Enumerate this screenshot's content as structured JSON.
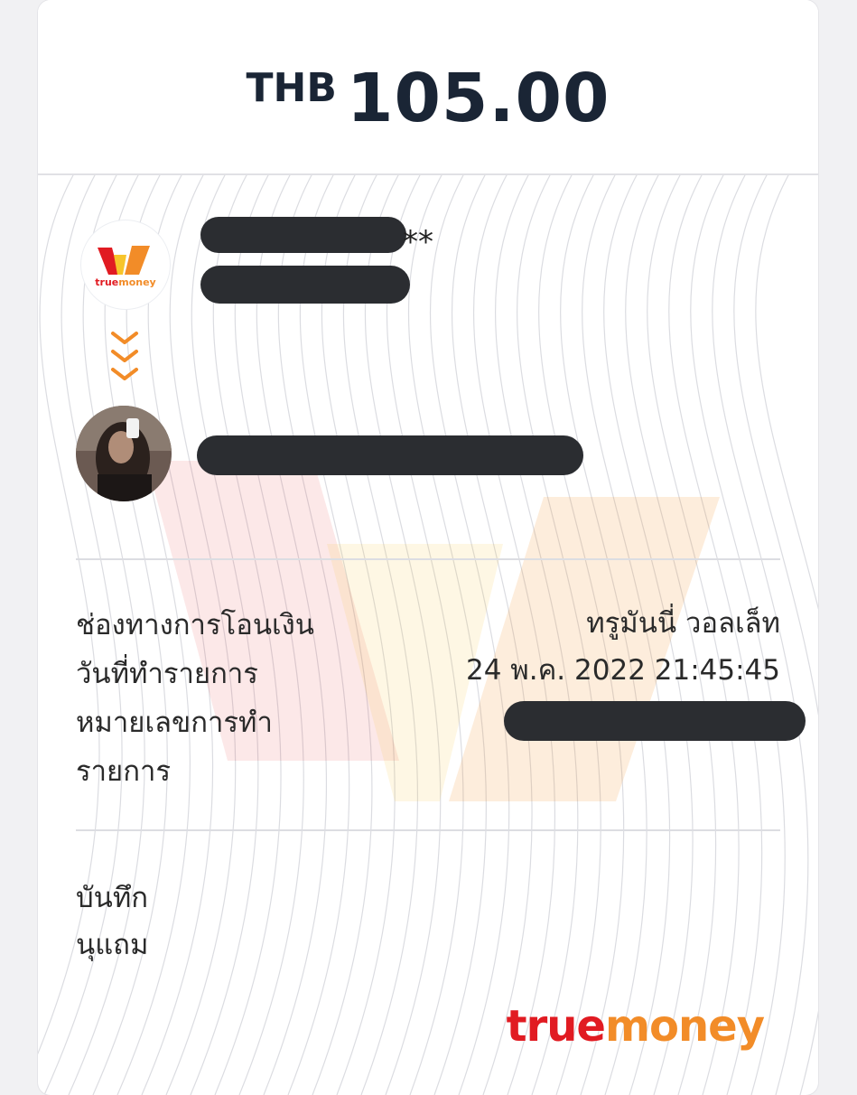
{
  "header": {
    "currency": "THB",
    "amount": "105.00"
  },
  "sender": {
    "logo_icon": "truemoney-logo-icon",
    "logo_text": "truemoney",
    "name_suffix": "**"
  },
  "transfer_icon": "chevron-down-triple-icon",
  "receiver": {
    "avatar_icon": "user-avatar-photo"
  },
  "details": {
    "channel_label": "ช่องทางการโอนเงิน",
    "channel_value": "ทรูมันนี่ วอลเล็ท",
    "date_label": "วันที่ทำรายการ",
    "date_value": "24 พ.ค. 2022 21:45:45",
    "ref_label_line1": "หมายเลขการทำ",
    "ref_label_line2": "รายการ"
  },
  "note": {
    "label": "บันทึก",
    "value": "นุแถม"
  },
  "footer": {
    "brand_part1": "true",
    "brand_part2": "money"
  },
  "colors": {
    "brand_red": "#e11b22",
    "brand_orange": "#f28c28",
    "brand_yellow": "#f7c52b",
    "text_dark": "#1a2535"
  }
}
